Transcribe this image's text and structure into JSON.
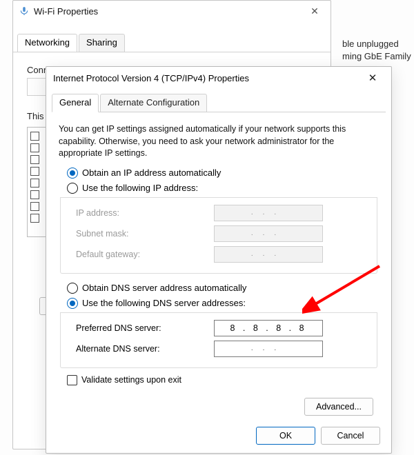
{
  "bg_text": {
    "l1": "ble unplugged",
    "l2": "ming GbE Family"
  },
  "wifi": {
    "title": "Wi-Fi Properties",
    "tabs": [
      "Networking",
      "Sharing"
    ],
    "connect_label": "Connect using:",
    "this_label": "This connection uses the following items:"
  },
  "ip": {
    "title": "Internet Protocol Version 4 (TCP/IPv4) Properties",
    "tabs": [
      "General",
      "Alternate Configuration"
    ],
    "desc": "You can get IP settings assigned automatically if your network supports this capability. Otherwise, you need to ask your network administrator for the appropriate IP settings.",
    "r_auto_ip": "Obtain an IP address automatically",
    "r_manual_ip": "Use the following IP address:",
    "ip_addr_label": "IP address:",
    "subnet_label": "Subnet mask:",
    "gateway_label": "Default gateway:",
    "r_auto_dns": "Obtain DNS server address automatically",
    "r_manual_dns": "Use the following DNS server addresses:",
    "pref_dns_label": "Preferred DNS server:",
    "alt_dns_label": "Alternate DNS server:",
    "pref_dns_value": "8  .  8  .  8  .  8",
    "validate": "Validate settings upon exit",
    "advanced": "Advanced...",
    "ok": "OK",
    "cancel": "Cancel"
  }
}
